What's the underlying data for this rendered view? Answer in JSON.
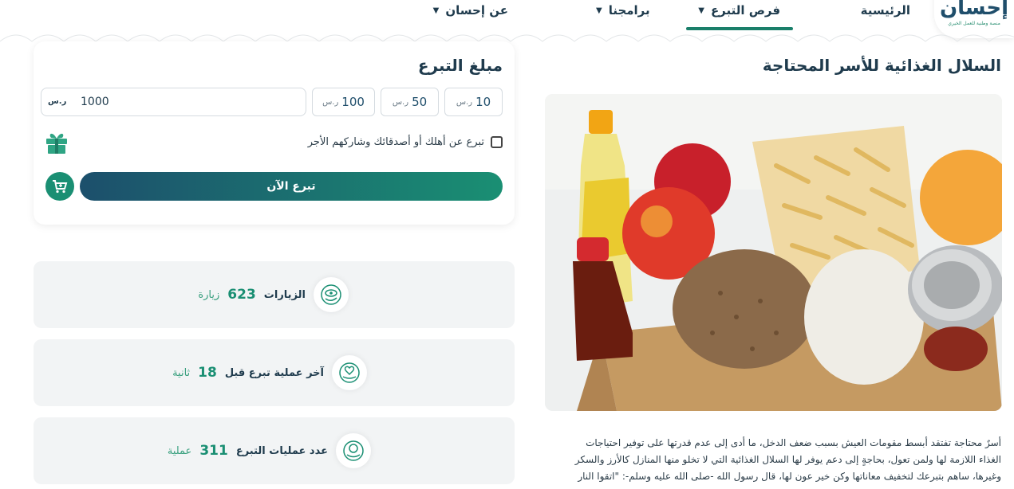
{
  "brand": {
    "logo": "إحسان",
    "tagline": "منصة وطنية للعمل الخيري"
  },
  "nav": {
    "home": "الرئيسية",
    "opportunities": "فرص التبرع",
    "programs": "برامجنا",
    "about": "عن إحسان"
  },
  "project": {
    "title": "السلال الغذائية للأسر المحتاجة",
    "image_alt": "food-basket-photo",
    "description_lines": [
      "أسرٌ محتاجة تفتقد أبسط مقومات العيش بسبب ضعف الدخل، ما أدى إلى عدم قدرتها على توفير احتياجات",
      "الغذاء اللازمة لها ولمن تعول، بحاجةٍ إلى دعم يوفر لها السلال الغذائية التي لا تخلو منها المنازل كالأرز والسكر",
      "وغيرها، ساهم بتبرعك لتخفيف معاناتها وكن خير عون لها، قال رسول الله -صلى الله عليه وسلم-: \"اتقوا النار"
    ]
  },
  "donation": {
    "title": "مبلغ التبرع",
    "currency": "ر.س",
    "amounts": [
      "10",
      "50",
      "100"
    ],
    "input_value": "1000",
    "gift_label": "تبرع عن أهلك أو أصدقائك وشاركهم الأجر",
    "donate_button": "تبرع الآن"
  },
  "stats": {
    "visits": {
      "label": "الزيارات",
      "value": "623",
      "unit": "زيارة"
    },
    "last_donation": {
      "label": "آخر عملية تبرع قبل",
      "value": "18",
      "unit": "ثانية"
    },
    "donations_count": {
      "label": "عدد عمليات التبرع",
      "value": "311",
      "unit": "عملية"
    }
  },
  "colors": {
    "primary": "#1a8f73",
    "dark": "#1f4e6b",
    "text": "#1f3b4d"
  }
}
